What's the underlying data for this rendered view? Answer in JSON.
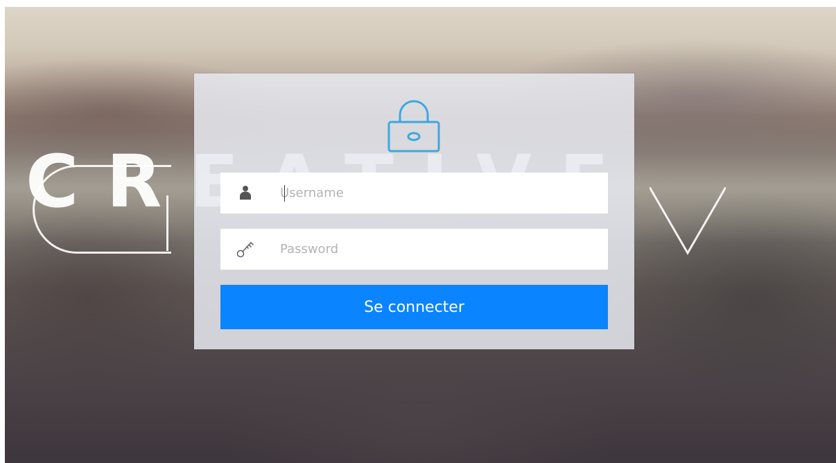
{
  "background": {
    "brand_text": "CREATIVE"
  },
  "login": {
    "username_placeholder": "Username",
    "password_placeholder": "Password",
    "submit_label": "Se connecter",
    "icons": {
      "header": "lock-icon",
      "username": "user-icon",
      "password": "key-icon"
    },
    "colors": {
      "accent": "#0a84ff",
      "lock_icon": "#3aa8e0"
    }
  }
}
